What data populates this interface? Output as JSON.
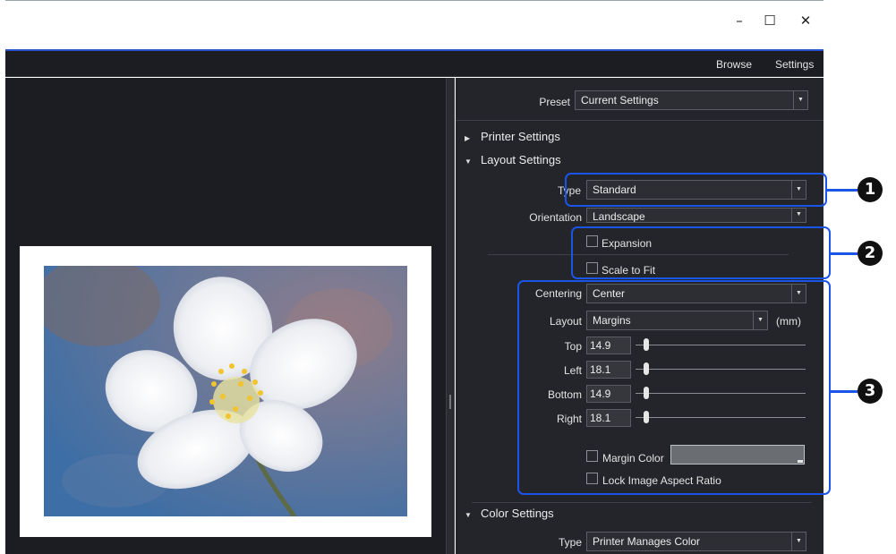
{
  "window": {
    "controls": {
      "minimize": "–",
      "maximize": "☐",
      "close": "✕"
    }
  },
  "menu": {
    "items": [
      "Browse",
      "Settings"
    ]
  },
  "preset": {
    "label": "Preset",
    "value": "Current Settings"
  },
  "sections": {
    "printer": "Printer Settings",
    "layout": "Layout Settings",
    "color": "Color Settings"
  },
  "layout_settings": {
    "type": {
      "label": "Type",
      "value": "Standard"
    },
    "orientation": {
      "label": "Orientation",
      "value": "Landscape"
    },
    "expansion": {
      "label": "Expansion",
      "checked": false
    },
    "scale_to_fit": {
      "label": "Scale to Fit",
      "checked": false
    },
    "centering": {
      "label": "Centering",
      "value": "Center"
    },
    "layout": {
      "label": "Layout",
      "value": "Margins",
      "unit": "(mm)"
    },
    "margins": [
      {
        "label": "Top",
        "value": "14.9"
      },
      {
        "label": "Left",
        "value": "18.1"
      },
      {
        "label": "Bottom",
        "value": "14.9"
      },
      {
        "label": "Right",
        "value": "18.1"
      }
    ],
    "margin_color": {
      "label": "Margin Color",
      "checked": false,
      "color": "#6a6d72"
    },
    "lock_aspect": {
      "label": "Lock Image Aspect Ratio",
      "checked": false
    }
  },
  "color_settings": {
    "type": {
      "label": "Type",
      "value": "Printer Manages Color"
    }
  },
  "callouts": [
    "1",
    "2",
    "3"
  ],
  "colors": {
    "accent": "#1b55e8",
    "panel": "#23252a",
    "preview_bg": "#1b1d22"
  }
}
